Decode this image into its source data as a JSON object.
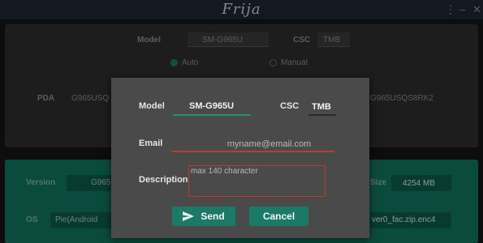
{
  "app": {
    "title": "Frija"
  },
  "background": {
    "model_label": "Model",
    "model_value": "SM-G965U",
    "csc_label": "CSC",
    "csc_value": "TMB",
    "mode_auto": "Auto",
    "mode_manual": "Manual",
    "pda_label": "PDA",
    "pda_value_left": "G965USQ",
    "pda_value_right": "G965USQS8RK2",
    "version_label": "Version",
    "version_value": "G965",
    "size_label": "Size",
    "size_value": "4254 MB",
    "os_label": "OS",
    "os_value": "Pie(Android",
    "file_value": "ver0_fac.zip.enc4"
  },
  "dialog": {
    "model_label": "Model",
    "model_value": "SM-G965U",
    "csc_label": "CSC",
    "csc_value": "TMB",
    "email_label": "Email",
    "email_placeholder": "myname@email.com",
    "description_label": "Description",
    "description_placeholder": "max 140 character",
    "send_label": "Send",
    "cancel_label": "Cancel"
  },
  "colors": {
    "accent": "#1b7a66",
    "error_outline": "#c0392b",
    "titlebar": "#1d2733"
  }
}
